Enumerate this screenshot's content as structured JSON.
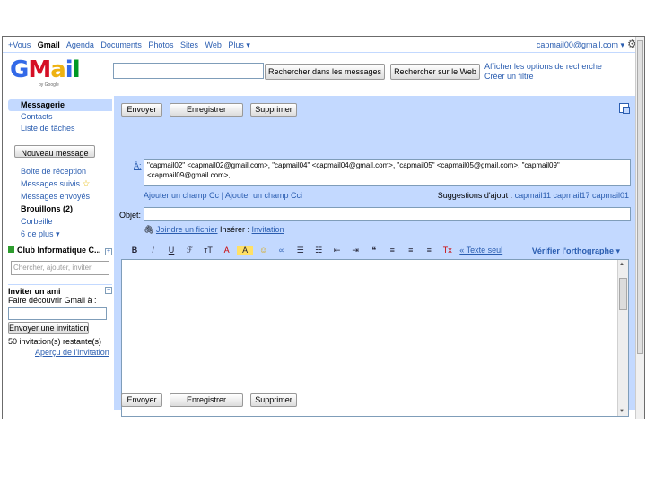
{
  "topbar": {
    "links": [
      "+Vous",
      "Gmail",
      "Agenda",
      "Documents",
      "Photos",
      "Sites",
      "Web",
      "Plus ▾"
    ],
    "account": "capmail00@gmail.com ▾"
  },
  "logo": {
    "g": "G",
    "m": "M",
    "a": "a",
    "i": "i",
    "l": "l",
    "by": "by Google"
  },
  "search": {
    "mail_button": "Rechercher dans les messages",
    "web_button": "Rechercher sur le Web",
    "options_link": "Afficher les options de recherche",
    "filter_link": "Créer un filtre"
  },
  "sidebar": {
    "top_items": [
      "Messagerie",
      "Contacts",
      "Liste de tâches"
    ],
    "compose_label": "Nouveau message",
    "folders": [
      "Boîte de réception",
      "Messages suivis",
      "Messages envoyés",
      "Brouillons (2)",
      "Corbeille",
      "6 de plus ▾"
    ],
    "star": "☆",
    "chat_title": "Club Informatique C...",
    "chat_plus": "+",
    "chat_search_placeholder": "Chercher, ajouter, inviter",
    "invite_title": "Inviter un ami",
    "invite_minus": "−",
    "invite_text": "Faire découvrir Gmail à :",
    "invite_button": "Envoyer une invitation",
    "invite_remaining": "50 invitation(s) restante(s)",
    "invite_preview": "Aperçu de l'invitation"
  },
  "compose": {
    "send": "Envoyer",
    "save": "Enregistrer",
    "delete": "Supprimer",
    "to_label": "À:",
    "to_value": "\"capmail02\" <capmail02@gmail.com>, \"capmail04\" <capmail04@gmail.com>, \"capmail05\" <capmail05@gmail.com>, \"capmail09\" <capmail09@gmail.com>,",
    "add_cc": "Ajouter un champ Cc",
    "add_bcc": "Ajouter un champ Cci",
    "separator": "|",
    "suggest_label": "Suggestions d'ajout :",
    "suggest_values": "capmail11 capmail17 capmail01",
    "subject_label": "Objet:",
    "attach_link": "Joindre un fichier",
    "insert_label": "Insérer :",
    "invite_link": "Invitation",
    "fmt_icons": [
      "B",
      "I",
      "U",
      "ℱ",
      "ᴛT",
      "A",
      "A",
      "☺",
      "∞",
      "☰",
      "☷",
      "⇤",
      "⇥",
      "❝",
      "≡",
      "≡",
      "≡",
      "Tx"
    ],
    "plain_text_link": "« Texte seul",
    "spell_link": "Vérifier l'orthographe ▾"
  }
}
